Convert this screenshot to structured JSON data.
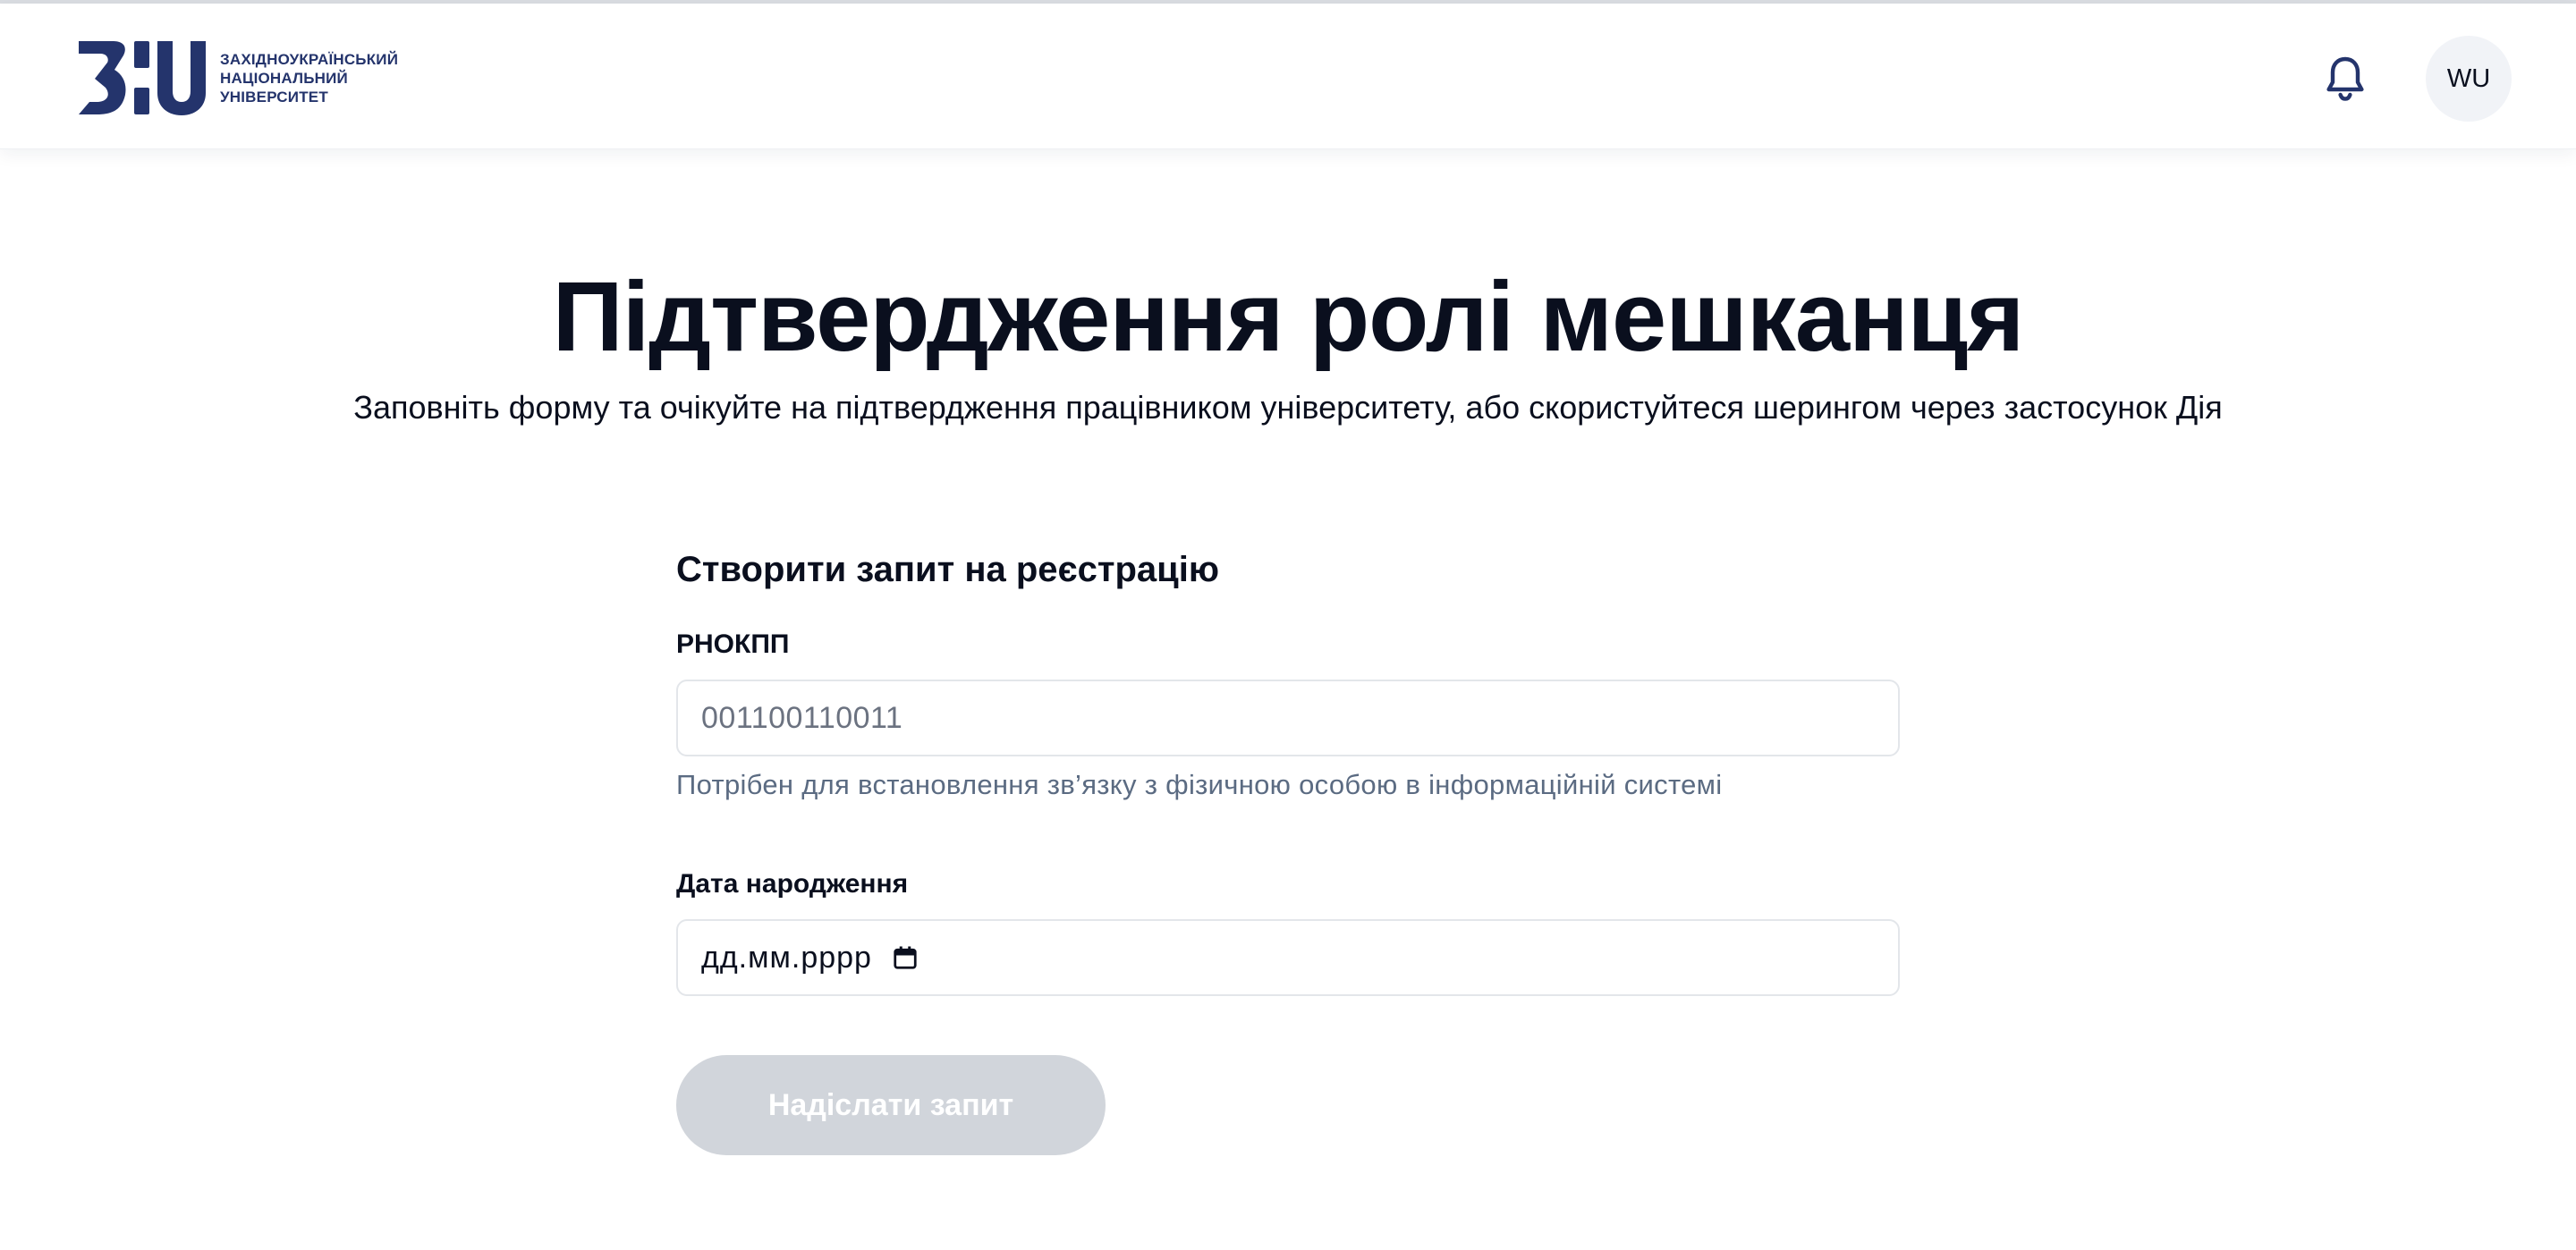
{
  "header": {
    "logo": {
      "lines": [
        "ЗАХІДНОУКРАЇНСЬКИЙ",
        "НАЦІОНАЛЬНИЙ",
        "УНІВЕРСИТЕТ"
      ],
      "brand_color": "#24346c"
    },
    "notifications_icon": "bell-icon",
    "avatar_initials": "WU"
  },
  "page": {
    "title": "Підтвердження ролі мешканця",
    "subtitle": "Заповніть форму та очікуйте на підтвердження працівником університету, або скористуйтеся шерингом через застосунок Дія"
  },
  "form": {
    "heading": "Створити запит на реєстрацію",
    "rnokpp": {
      "label": "РНОКПП",
      "placeholder": "001100110011",
      "hint": "Потрібен для встановлення зв’язку з фізичною особою в інформаційній системі"
    },
    "birth_date": {
      "label": "Дата народження",
      "placeholder": "дд.мм.рррр",
      "icon": "calendar-icon"
    },
    "submit": {
      "label": "Надіслати запит",
      "disabled": true,
      "disabled_color": "#d1d5db"
    }
  }
}
